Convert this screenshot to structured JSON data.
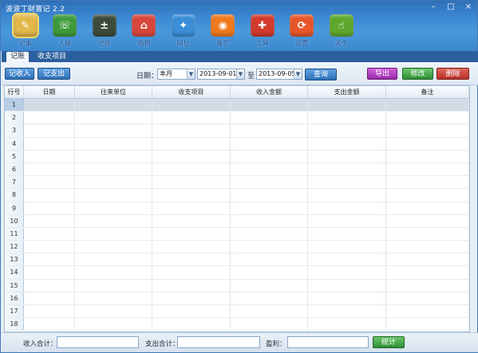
{
  "app": {
    "title": "波波丁财富记 2.2"
  },
  "window_controls": {
    "minimize": "–",
    "maximize": "□",
    "close": "×"
  },
  "toolbar": [
    {
      "label": "记事",
      "icon": "notebook-icon",
      "glyph": "✎",
      "color": "#e2b84a",
      "active": true
    },
    {
      "label": "人脉",
      "icon": "phone-icon",
      "glyph": "☏",
      "color": "#3d9a3a"
    },
    {
      "label": "记账",
      "icon": "blackboard-icon",
      "glyph": "±",
      "color": "#3d4b3b"
    },
    {
      "label": "购物",
      "icon": "shop-icon",
      "glyph": "⌂",
      "color": "#d9473c"
    },
    {
      "label": "网址",
      "icon": "globe-icon",
      "glyph": "✦",
      "color": "#3a8fd8"
    },
    {
      "label": "备忘",
      "icon": "rss-icon",
      "glyph": "◉",
      "color": "#ef7a1e"
    },
    {
      "label": "工具",
      "icon": "tool-icon",
      "glyph": "✚",
      "color": "#d33a2c"
    },
    {
      "label": "设置",
      "icon": "settings-icon",
      "glyph": "⟳",
      "color": "#e8572a"
    },
    {
      "label": "关于",
      "icon": "thumbs-up-icon",
      "glyph": "☝",
      "color": "#5fa82d"
    }
  ],
  "tabs": [
    {
      "label": "记账"
    },
    {
      "label": "收支项目"
    }
  ],
  "actions": {
    "add_income": "记收入",
    "add_expense": "记支出",
    "date_label": "日期：",
    "period_select": "本月",
    "date_from": "2013-09-01",
    "to_label": "至",
    "date_to": "2013-09-05",
    "query": "查询",
    "export": "导出",
    "edit": "修改",
    "delete": "删除"
  },
  "table": {
    "columns": [
      "行号",
      "日期",
      "往来单位",
      "收支项目",
      "收入金额",
      "支出金额",
      "备注"
    ],
    "row_numbers": [
      "1",
      "2",
      "3",
      "4",
      "5",
      "6",
      "7",
      "8",
      "9",
      "10",
      "11",
      "12",
      "13",
      "14",
      "15",
      "16",
      "17",
      "18"
    ],
    "selected_row": 1
  },
  "footer": {
    "income_total_label": "收入合计：",
    "income_total_value": "",
    "expense_total_label": "支出合计：",
    "expense_total_value": "",
    "profit_label": "盈利：",
    "profit_value": "",
    "stats_button": "统计"
  }
}
